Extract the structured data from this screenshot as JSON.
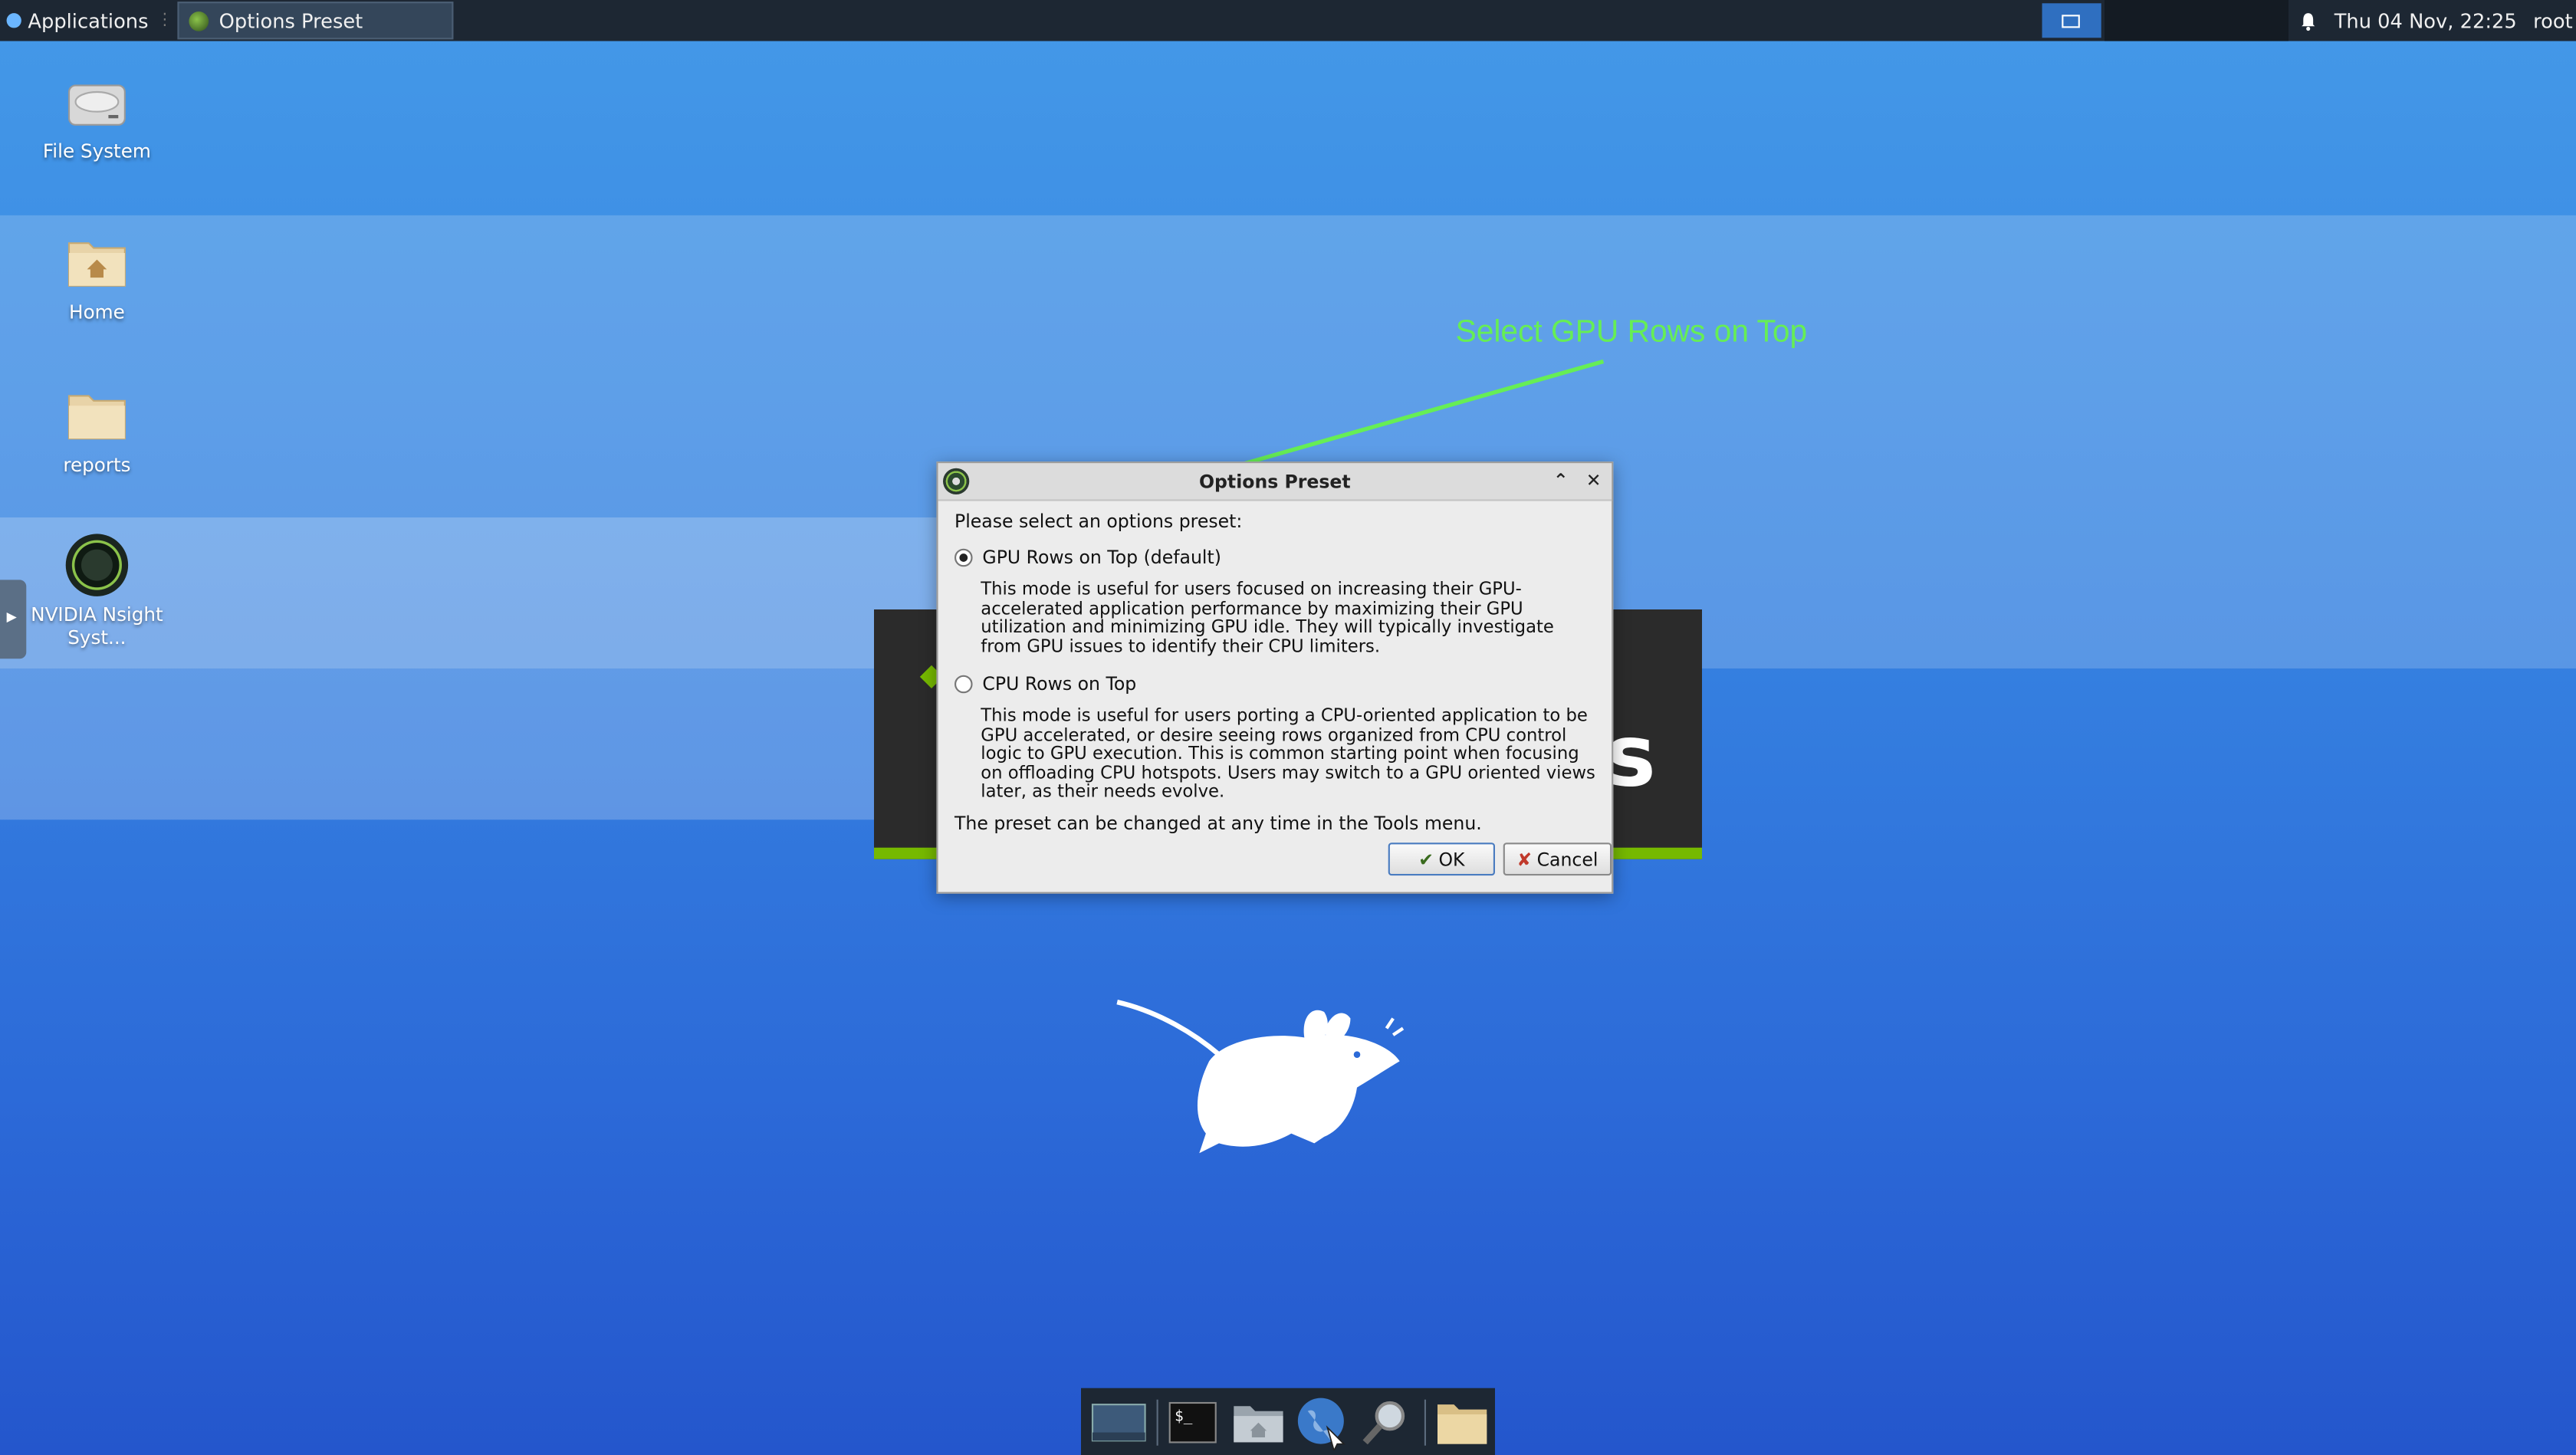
{
  "top_panel": {
    "applications_label": "Applications",
    "separator": "⋮",
    "task_title": "Options Preset",
    "clock": "Thu 04 Nov, 22:25",
    "user": "root"
  },
  "desktop": {
    "icons": [
      {
        "label": "File System"
      },
      {
        "label": "Home"
      },
      {
        "label": "reports"
      },
      {
        "label": "NVIDIA Nsight Syst..."
      }
    ]
  },
  "splash": {
    "partial_text": "s"
  },
  "annotation": {
    "text": "Select GPU Rows on Top",
    "color": "#66ee55"
  },
  "dialog": {
    "title": "Options Preset",
    "prompt": "Please select an options preset:",
    "options": [
      {
        "label": "GPU Rows on Top (default)",
        "selected": true,
        "description": "This mode is useful for users focused on increasing their GPU-accelerated application performance by maximizing their GPU utilization and minimizing GPU idle. They will typically investigate from GPU issues to identify their CPU limiters."
      },
      {
        "label": "CPU Rows on Top",
        "selected": false,
        "description": "This mode is useful for users porting a CPU-oriented application to be GPU accelerated, or desire seeing rows organized from CPU control logic to GPU execution. This is common starting point when focusing on offloading CPU hotspots. Users may switch to a GPU oriented views later, as their needs evolve."
      }
    ],
    "footer_note": "The preset can be changed at any time in the Tools menu.",
    "ok_label": "OK",
    "cancel_label": "Cancel"
  },
  "dock": {
    "items": [
      "show-desktop",
      "terminal",
      "home-folder",
      "web-browser",
      "app-finder",
      "files"
    ]
  }
}
